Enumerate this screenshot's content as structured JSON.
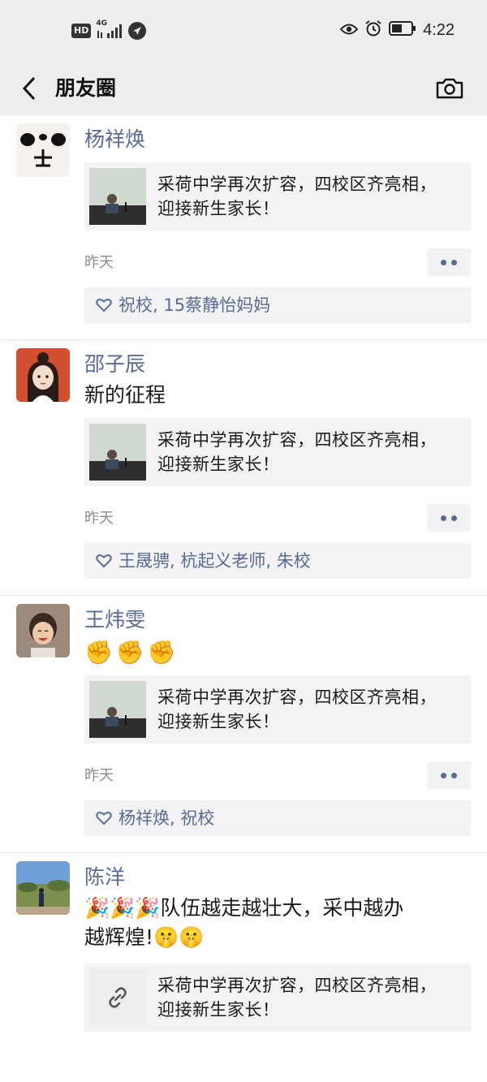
{
  "status_bar": {
    "badge": "HD",
    "network": "4G",
    "time": "4:22"
  },
  "nav": {
    "title": "朋友圈"
  },
  "posts": [
    {
      "author": "杨祥焕",
      "text": "",
      "link_title_line1": "采荷中学再次扩容，四校区齐亮相，",
      "link_title_line2": "迎接新生家长！",
      "time": "昨天",
      "likes": "祝校, 15蔡静怡妈妈"
    },
    {
      "author": "邵子辰",
      "text": "新的征程",
      "link_title_line1": "采荷中学再次扩容，四校区齐亮相，",
      "link_title_line2": "迎接新生家长！",
      "time": "昨天",
      "likes": "王晟骋, 杭起义老师, 朱校"
    },
    {
      "author": "王炜雯",
      "emojis": [
        "✊",
        "✊",
        "✊"
      ],
      "link_title_line1": "采荷中学再次扩容，四校区齐亮相，",
      "link_title_line2": "迎接新生家长！",
      "time": "昨天",
      "likes": "杨祥焕, 祝校"
    },
    {
      "author": "陈洋",
      "text_line1": "🎉🎉🎉队伍越走越壮大，采中越办",
      "text_line2": "越辉煌!🤫🤫",
      "link_title_line1": "采荷中学再次扩容，四校区齐亮相，",
      "link_title_line2": "迎接新生家长！"
    }
  ],
  "icons": {
    "back": "chevron-left-icon",
    "camera": "camera-icon",
    "like": "heart-outline-icon",
    "link": "link-icon",
    "more": "more-dots-icon"
  },
  "colors": {
    "bar_bg": "#ededed",
    "name_blue": "#576b95",
    "card_bg": "#f3f3f5",
    "time_gray": "#8c8c8c"
  }
}
